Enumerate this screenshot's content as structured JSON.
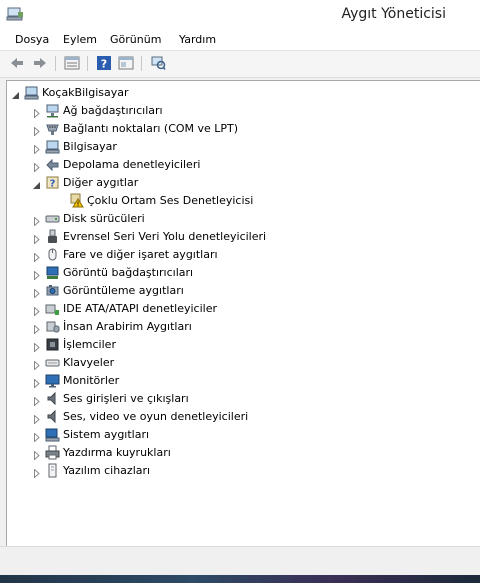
{
  "window": {
    "title": "Aygıt Yöneticisi",
    "app_icon": "device-manager-icon"
  },
  "menu": [
    "Dosya",
    "Eylem",
    "Görünüm",
    "Yardım"
  ],
  "toolbar": [
    "back-arrow-icon",
    "forward-arrow-icon",
    "properties-grid-icon",
    "help-icon",
    "details-pane-icon",
    "scan-hardware-icon"
  ],
  "tree": {
    "root": {
      "label": "KoçakBilgisayar",
      "icon": "computer-icon",
      "expanded": true
    },
    "items": [
      {
        "label": "Ağ bağdaştırıcıları",
        "icon": "network-adapter-icon",
        "expanded": false
      },
      {
        "label": "Bağlantı noktaları (COM ve LPT)",
        "icon": "port-icon",
        "expanded": false
      },
      {
        "label": "Bilgisayar",
        "icon": "computer-icon",
        "expanded": false
      },
      {
        "label": "Depolama denetleyicileri",
        "icon": "storage-controller-icon",
        "expanded": false
      },
      {
        "label": "Diğer aygıtlar",
        "icon": "unknown-device-icon",
        "expanded": true,
        "children": [
          {
            "label": "Çoklu Ortam Ses Denetleyicisi",
            "icon": "warning-device-icon"
          }
        ]
      },
      {
        "label": "Disk sürücüleri",
        "icon": "disk-drive-icon",
        "expanded": false
      },
      {
        "label": "Evrensel Seri Veri Yolu denetleyicileri",
        "icon": "usb-icon",
        "expanded": false
      },
      {
        "label": "Fare ve diğer işaret aygıtları",
        "icon": "mouse-icon",
        "expanded": false
      },
      {
        "label": "Görüntü bağdaştırıcıları",
        "icon": "display-adapter-icon",
        "expanded": false
      },
      {
        "label": "Görüntüleme aygıtları",
        "icon": "imaging-device-icon",
        "expanded": false
      },
      {
        "label": "IDE ATA/ATAPI denetleyiciler",
        "icon": "ide-controller-icon",
        "expanded": false
      },
      {
        "label": "İnsan Arabirim Aygıtları",
        "icon": "hid-icon",
        "expanded": false
      },
      {
        "label": "İşlemciler",
        "icon": "processor-icon",
        "expanded": false
      },
      {
        "label": "Klavyeler",
        "icon": "keyboard-icon",
        "expanded": false
      },
      {
        "label": "Monitörler",
        "icon": "monitor-icon",
        "expanded": false
      },
      {
        "label": "Ses girişleri ve çıkışları",
        "icon": "speaker-icon",
        "expanded": false
      },
      {
        "label": "Ses, video ve oyun denetleyicileri",
        "icon": "speaker-icon",
        "expanded": false
      },
      {
        "label": "Sistem aygıtları",
        "icon": "system-device-icon",
        "expanded": false
      },
      {
        "label": "Yazdırma kuyrukları",
        "icon": "printer-icon",
        "expanded": false
      },
      {
        "label": "Yazılım cihazları",
        "icon": "software-device-icon",
        "expanded": false
      }
    ]
  }
}
